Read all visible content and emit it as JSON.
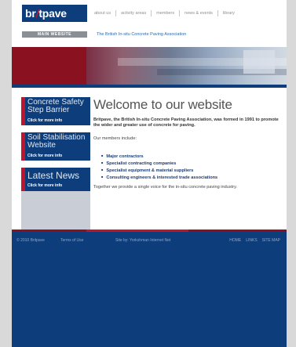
{
  "header": {
    "logo_text_pre": "br",
    "logo_text_slash": "/",
    "logo_text_post": "tpave",
    "main_website": "MAIN WEBSITE",
    "tagline": "The British In-situ Concrete Paving Association",
    "nav": [
      "about us",
      "activity areas",
      "members",
      "news & events",
      "library"
    ]
  },
  "sidebar": [
    {
      "title": "Concrete Safety Step Barrier",
      "more": "Click for more info"
    },
    {
      "title": "Soil Stabilisation Website",
      "more": "Click for more info"
    },
    {
      "title": "Latest News",
      "more": "Click for more info"
    }
  ],
  "main": {
    "title": "Welcome to our website",
    "intro": "Britpave, the British In-situ Concrete Paving Association, was formed in 1991 to promote the wider and greater use of concrete for paving.",
    "members_intro": "Our members include:",
    "members": [
      "Major contractors",
      "Specialist contracting companies",
      "Specialist equipment & material suppliers",
      "Consulting engineers & interested trade associations"
    ],
    "together": "Together we provide a single voice for the in-situ concrete paving industry."
  },
  "footer": {
    "copyright": "© 2010 Britpave",
    "terms": "Terms of Use",
    "site_by": "Site by: Yorkshman Internet Net",
    "links": [
      "HOME",
      "LINKS",
      "SITE MAP"
    ]
  },
  "colors": {
    "navy": "#0d3d7a",
    "red": "#c0152f",
    "gray": "#8a8f96"
  }
}
